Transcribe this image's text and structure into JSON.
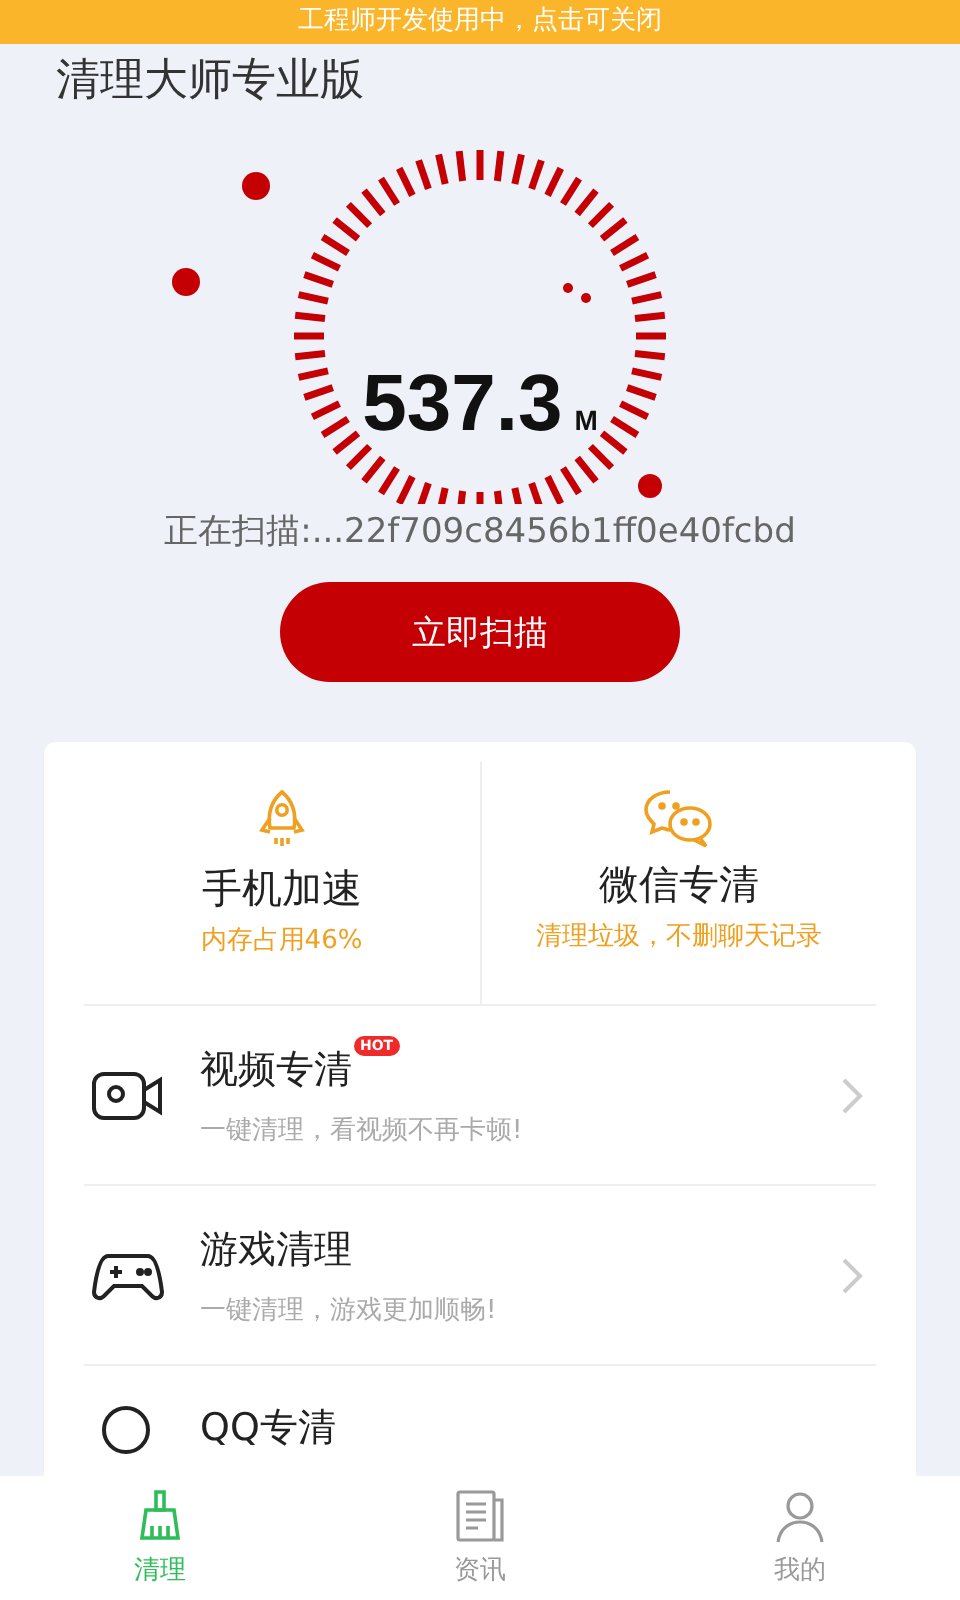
{
  "dev_banner": "工程师开发使用中，点击可关闭",
  "app_title": "清理大师专业版",
  "scan": {
    "size": "537.3",
    "unit": "M",
    "status": "正在扫描:...22f709c8456b1ff0e40fcbd",
    "button": "立即扫描"
  },
  "features": [
    {
      "title": "手机加速",
      "subtitle": "内存占用46%"
    },
    {
      "title": "微信专清",
      "subtitle": "清理垃圾，不删聊天记录"
    }
  ],
  "tools": [
    {
      "title": "视频专清",
      "badge": "HOT",
      "subtitle": "一键清理，看视频不再卡顿!"
    },
    {
      "title": "游戏清理",
      "subtitle": "一键清理，游戏更加顺畅!"
    },
    {
      "title": "QQ专清"
    }
  ],
  "tabs": [
    {
      "label": "清理",
      "selected": true
    },
    {
      "label": "资讯",
      "selected": false
    },
    {
      "label": "我的",
      "selected": false
    }
  ]
}
